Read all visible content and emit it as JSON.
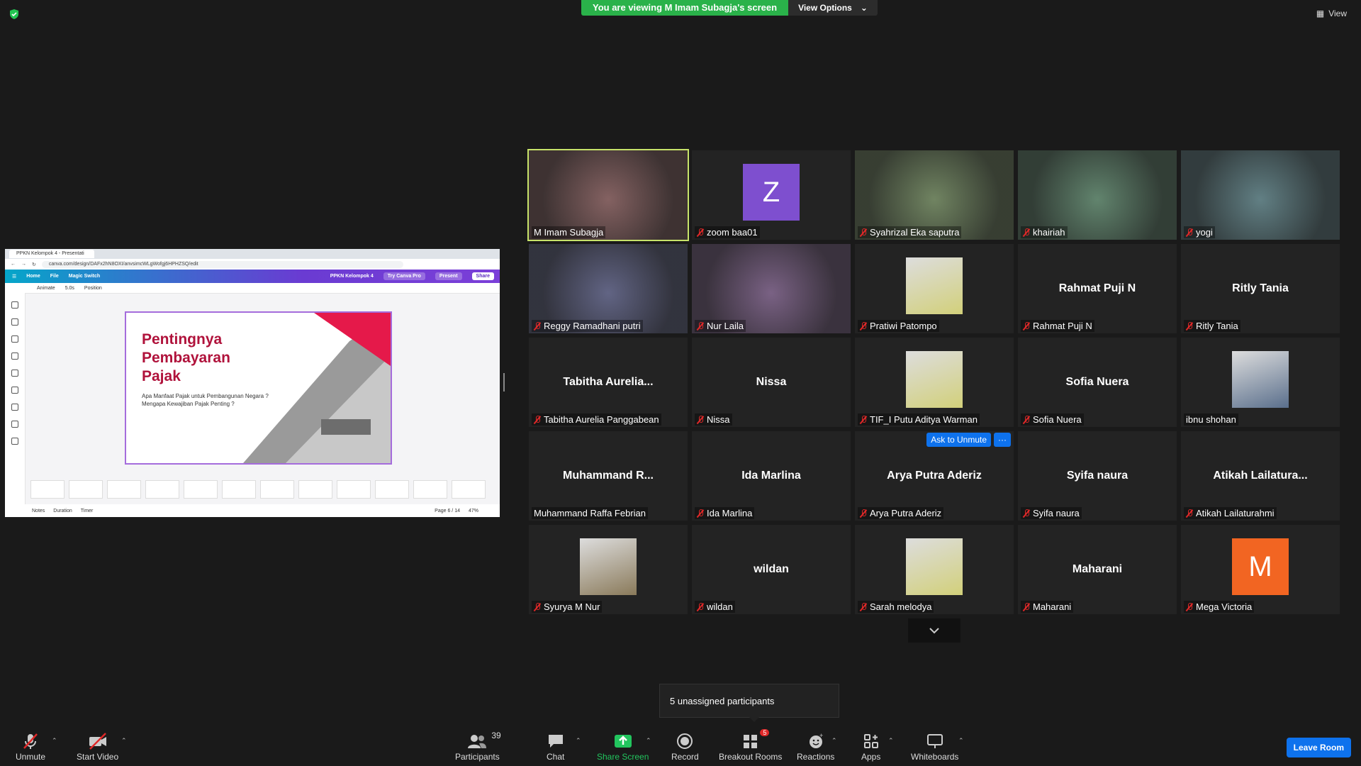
{
  "banner": {
    "viewing": "You are viewing M Imam Subagja's screen",
    "view_options": "View Options"
  },
  "view_label": "View",
  "shared": {
    "tab_title": "PPKN Kelompok 4 - Presentati",
    "url": "canva.com/design/DAFx2hN8OXI/anvsimcWLgWofgj6HPHZSQ/edit",
    "menu": [
      "Home",
      "File",
      "Magic Switch"
    ],
    "doc_title": "PPKN Kelompok 4",
    "try_pro": "Try Canva Pro",
    "present": "Present",
    "share": "Share",
    "sub": [
      "Animate",
      "5.0s",
      "Position"
    ],
    "slide_title": "Pentingnya Pembayaran Pajak",
    "slide_q1": "Apa Manfaat Pajak untuk Pembangunan Negara ?",
    "slide_q2": "Mengapa Kewajiban Pajak Penting ?",
    "foot_notes": "Notes",
    "foot_duration": "Duration",
    "foot_timer": "Timer",
    "page": "Page 6 / 14",
    "zoom": "47%"
  },
  "participants_tiles": [
    {
      "name": "M Imam Subagja",
      "type": "video",
      "muted": false,
      "active": true
    },
    {
      "name": "zoom baa01",
      "type": "avatar",
      "letter": "Z",
      "color": "#7e4fcf",
      "muted": true
    },
    {
      "name": "Syahrizal Eka saputra",
      "type": "video",
      "muted": true
    },
    {
      "name": "khairiah",
      "type": "video",
      "muted": true
    },
    {
      "name": "yogi",
      "type": "video",
      "muted": true
    },
    {
      "name": "Reggy Ramadhani putri",
      "type": "video",
      "muted": true
    },
    {
      "name": "Nur Laila",
      "type": "video",
      "muted": true
    },
    {
      "name": "Pratiwi Patompo",
      "type": "photo",
      "muted": true
    },
    {
      "name": "Rahmat Puji N",
      "type": "text",
      "big": "Rahmat Puji N",
      "muted": true
    },
    {
      "name": "Ritly Tania",
      "type": "text",
      "big": "Ritly Tania",
      "muted": true
    },
    {
      "name": "Tabitha Aurelia Panggabean",
      "type": "text",
      "big": "Tabitha  Aurelia...",
      "muted": true
    },
    {
      "name": "Nissa",
      "type": "text",
      "big": "Nissa",
      "muted": true
    },
    {
      "name": "TIF_I Putu Aditya Warman",
      "type": "photo",
      "muted": true
    },
    {
      "name": "Sofia Nuera",
      "type": "text",
      "big": "Sofia Nuera",
      "muted": true
    },
    {
      "name": "ibnu shohan",
      "type": "photo",
      "muted": false
    },
    {
      "name": "Muhammand Raffa Febrian",
      "type": "text",
      "big": "Muhammand  R...",
      "muted": false
    },
    {
      "name": "Ida Marlina",
      "type": "text",
      "big": "Ida Marlina",
      "muted": true
    },
    {
      "name": "Arya Putra Aderiz",
      "type": "text",
      "big": "Arya Putra Aderiz",
      "muted": true,
      "ask": "Ask to Unmute",
      "more": "···"
    },
    {
      "name": "Syifa naura",
      "type": "text",
      "big": "Syifa naura",
      "muted": true
    },
    {
      "name": "Atikah Lailaturahmi",
      "type": "text",
      "big": "Atikah  Lailatura...",
      "muted": true
    },
    {
      "name": "Syurya M Nur",
      "type": "photo",
      "muted": true
    },
    {
      "name": "wildan",
      "type": "text",
      "big": "wildan",
      "muted": true
    },
    {
      "name": "Sarah melodya",
      "type": "photo",
      "muted": true
    },
    {
      "name": "Maharani",
      "type": "text",
      "big": "Maharani",
      "muted": true
    },
    {
      "name": "Mega Victoria",
      "type": "avatar",
      "letter": "M",
      "color": "#f26522",
      "muted": true
    }
  ],
  "tooltip": "5 unassigned participants",
  "toolbar": {
    "unmute": "Unmute",
    "start_video": "Start Video",
    "participants": "Participants",
    "participants_count": "39",
    "chat": "Chat",
    "share_screen": "Share Screen",
    "record": "Record",
    "breakout": "Breakout Rooms",
    "breakout_badge": "5",
    "reactions": "Reactions",
    "apps": "Apps",
    "whiteboards": "Whiteboards",
    "leave": "Leave Room"
  },
  "colors": {
    "accent": "#0e72ed",
    "green": "#2ab24a",
    "active_border": "#c7e36a",
    "muted": "#e02828"
  }
}
